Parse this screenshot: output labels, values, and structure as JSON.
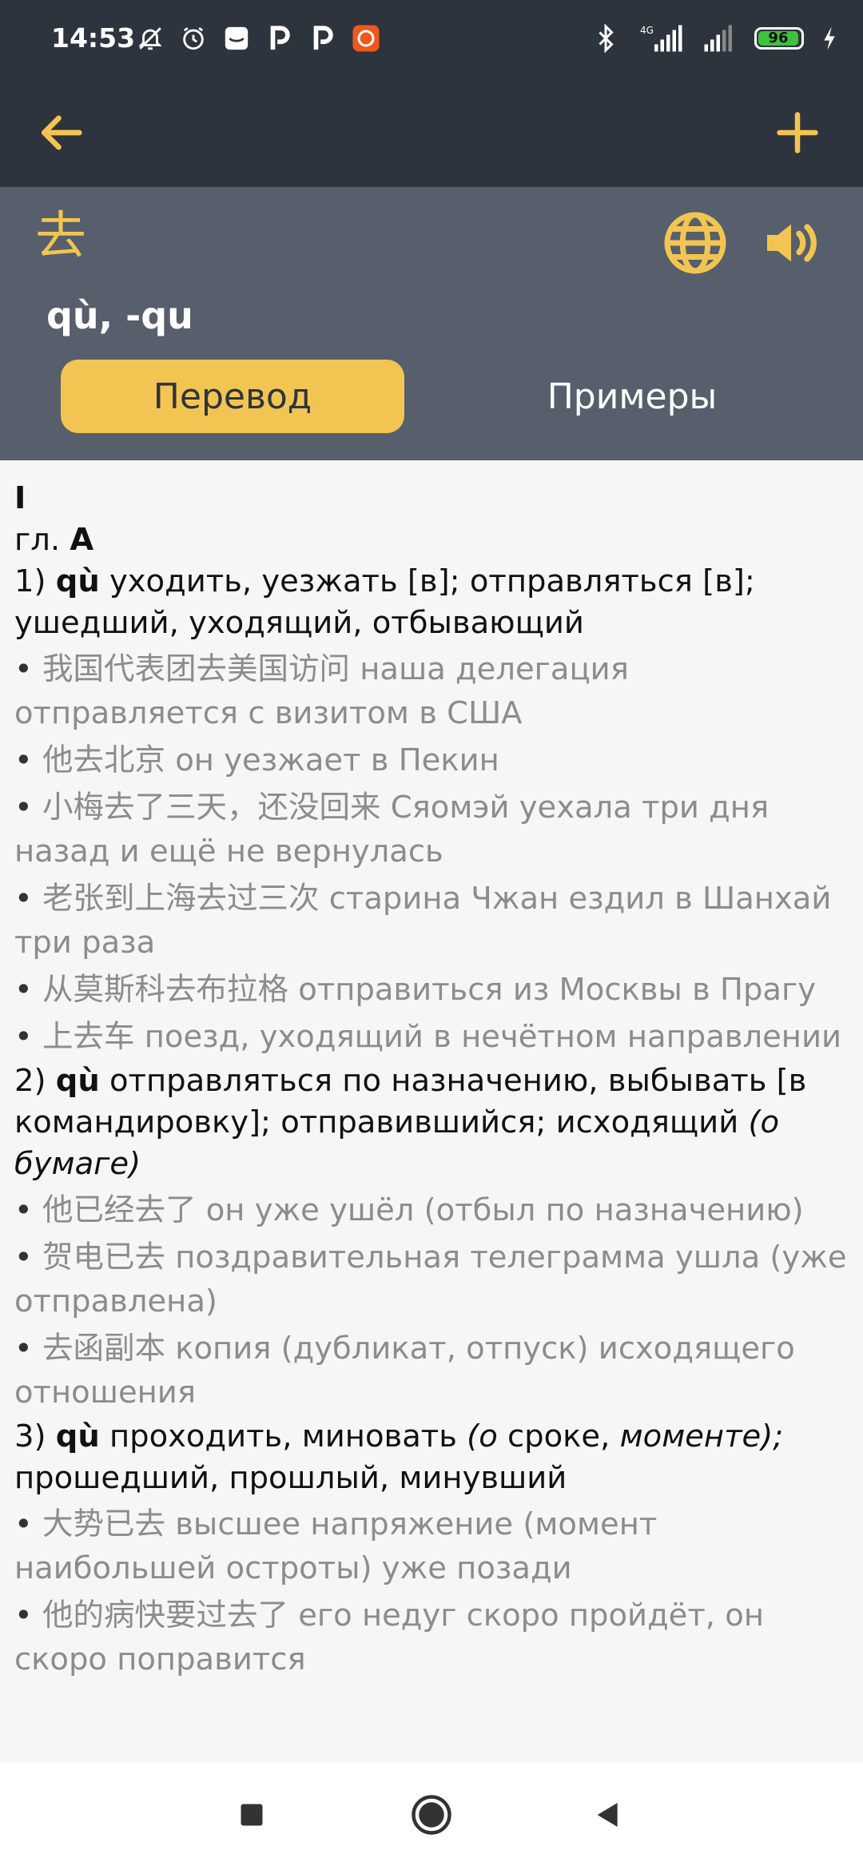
{
  "status_bar": {
    "time": "14:53",
    "left_icons": [
      "bell-off-icon",
      "alarm-icon",
      "message-icon",
      "p-app-icon",
      "p-app-icon",
      "app-icon"
    ],
    "network_label": "4G",
    "battery_level": "96",
    "right_icons": [
      "bluetooth-icon",
      "signal-icon",
      "signal-icon",
      "battery-icon",
      "charging-icon"
    ]
  },
  "toolbar": {
    "back_icon": "arrow-left-icon",
    "add_icon": "plus-icon",
    "accent_color": "#f2c552"
  },
  "entry": {
    "hanzi": "去",
    "pinyin": "qù, -qu",
    "globe_icon": "globe-icon",
    "sound_icon": "speaker-icon"
  },
  "tabs": [
    {
      "label": "Перевод",
      "active": true
    },
    {
      "label": "Примеры",
      "active": false
    }
  ],
  "content": {
    "roman": "I",
    "pos_prefix": "гл.",
    "pos_letter": "А",
    "senses": [
      {
        "number": "1)",
        "pinyin": "qù",
        "text": "уходить, уезжать [в]; отправляться [в]; ушедший, уходящий, отбывающий",
        "examples": [
          {
            "zh": "我国代表团去美国访问",
            "ru": "наша делегация отправляется с визитом в США"
          },
          {
            "zh": "他去北京",
            "ru": "он уезжает в Пекин"
          },
          {
            "zh": "小梅去了三天，还没回来",
            "ru": "Сяомэй уехала три дня назад и ещё не вернулась"
          },
          {
            "zh": "老张到上海去过三次",
            "ru": "старина Чжан ездил в Шанхай три раза"
          },
          {
            "zh": "从莫斯科去布拉格",
            "ru": "отправиться из Москвы в Прагу"
          },
          {
            "zh": "上去车",
            "ru": "поезд, уходящий в нечётном направлении"
          }
        ]
      },
      {
        "number": "2)",
        "pinyin": "qù",
        "text": "отправляться по назначению, выбывать [в командировку]; отправившийся; исходящий",
        "italic": "(о бумаге)",
        "examples": [
          {
            "zh": "他已经去了",
            "ru": "он уже ушёл (отбыл по назначению)"
          },
          {
            "zh": "贺电已去",
            "ru": "поздравительная телеграмма ушла (уже отправлена)"
          },
          {
            "zh": "去函副本",
            "ru": "копия (дубликат, отпуск) исходящего отношения"
          }
        ]
      },
      {
        "number": "3)",
        "pinyin": "qù",
        "text_before": "проходить, миновать",
        "italic_open": "(о",
        "plain_mid": "сроке,",
        "italic_close": "моменте);",
        "text_after": "прошедший, прошлый, минувший",
        "examples": [
          {
            "zh": "大势已去",
            "ru": "высшее напряжение (момент наибольшей остроты) уже позади"
          },
          {
            "zh": "他的病快要过去了",
            "ru": "его недуг скоро пройдёт, он скоро поправится"
          }
        ]
      }
    ]
  },
  "nav_bar": {
    "recents_icon": "square-icon",
    "home_icon": "circle-icon",
    "back_icon": "triangle-back-icon"
  }
}
